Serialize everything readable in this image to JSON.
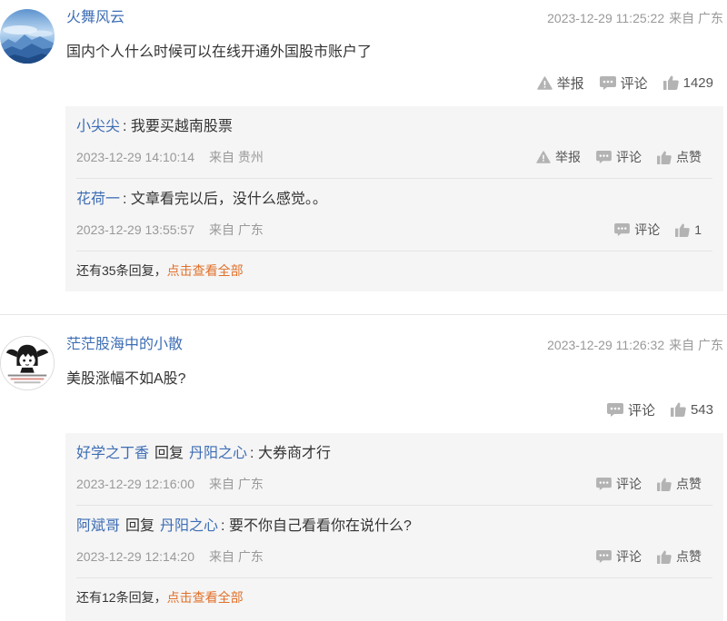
{
  "colors": {
    "link_blue": "#3d6db5",
    "more_orange": "#e0702a",
    "meta_gray": "#999999",
    "text_dark": "#333333",
    "reply_bg": "#f5f5f5"
  },
  "icons": {
    "report": "warning-icon",
    "comment": "comment-icon",
    "like": "thumbs-up-icon"
  },
  "comments": [
    {
      "user": "火舞风云",
      "time": "2023-12-29 11:25:22",
      "location": "来自 广东",
      "text": "国内个人什么时候可以在线开通外国股市账户了",
      "report_label": "举报",
      "comment_label": "评论",
      "likes": "1429",
      "replies": [
        {
          "user": "小尖尖",
          "text": ": 我要买越南股票",
          "time": "2023-12-29 14:10:14",
          "location": "来自 贵州",
          "report_label": "举报",
          "comment_label": "评论",
          "like_label": "点赞"
        },
        {
          "user": "花荷一",
          "text": ": 文章看完以后，没什么感觉。。",
          "time": "2023-12-29 13:55:57",
          "location": "来自 广东",
          "comment_label": "评论",
          "like_label": "1"
        }
      ],
      "more_text": "还有35条回复，",
      "more_link": "点击查看全部"
    },
    {
      "user": "茫茫股海中的小散",
      "time": "2023-12-29 11:26:32",
      "location": "来自 广东",
      "text": "美股涨幅不如A股?",
      "comment_label": "评论",
      "likes": "543",
      "replies": [
        {
          "user": "好学之丁香",
          "reply_word": "回复",
          "target": "丹阳之心",
          "text": ": 大券商才行",
          "time": "2023-12-29 12:16:00",
          "location": "来自 广东",
          "comment_label": "评论",
          "like_label": "点赞"
        },
        {
          "user": "阿斌哥",
          "reply_word": "回复",
          "target": "丹阳之心",
          "text": ": 要不你自己看看你在说什么?",
          "time": "2023-12-29 12:14:20",
          "location": "来自 广东",
          "comment_label": "评论",
          "like_label": "点赞"
        }
      ],
      "more_text": "还有12条回复，",
      "more_link": "点击查看全部"
    }
  ]
}
